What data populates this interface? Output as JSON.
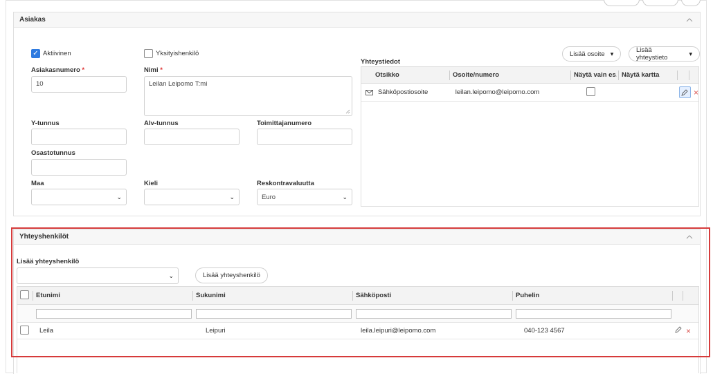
{
  "customer": {
    "title": "Asiakas",
    "active_label": "Aktiivinen",
    "active_checked": true,
    "private_label": "Yksityishenkilö",
    "private_checked": false,
    "customer_number_label": "Asiakasnumero",
    "customer_number_value": "10",
    "name_label": "Nimi",
    "name_value": "Leilan Leipomo T:mi",
    "required_mark": "*",
    "business_id_label": "Y-tunnus",
    "vat_id_label": "Alv-tunnus",
    "supplier_number_label": "Toimittajanumero",
    "department_label": "Osastotunnus",
    "country_label": "Maa",
    "country_value": "",
    "language_label": "Kieli",
    "language_value": "",
    "ledger_currency_label": "Reskontravaluutta",
    "ledger_currency_value": "Euro"
  },
  "contact_info": {
    "title": "Yhteystiedot",
    "add_address_label": "Lisää osoite",
    "add_contact_info_label": "Lisää yhteystieto",
    "columns": [
      "Otsikko",
      "Osoite/numero",
      "Näytä vain es…",
      "Näytä kartta"
    ],
    "rows": [
      {
        "icon": "envelope-icon",
        "title": "Sähköpostiosoite",
        "address": "leilan.leipomo@leipomo.com",
        "show_only_checked": false
      }
    ]
  },
  "contacts": {
    "title": "Yhteyshenkilöt",
    "add_contact_person_label": "Lisää yhteyshenkilö",
    "add_contact_person_select_value": "",
    "add_contact_person_button": "Lisää yhteyshenkilö",
    "columns": [
      "Etunimi",
      "Sukunimi",
      "Sähköposti",
      "Puhelin"
    ],
    "rows": [
      {
        "first_name": "Leila",
        "last_name": "Leipuri",
        "email": "leila.leipuri@leipomo.com",
        "phone": "040-123 4567"
      }
    ]
  },
  "colors": {
    "accent": "#2f7be0",
    "highlight_border": "#d63b3b",
    "delete": "#d9534f"
  }
}
